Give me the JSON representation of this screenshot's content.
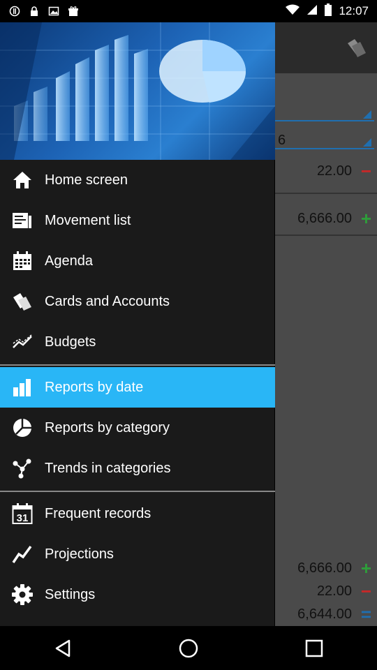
{
  "status_bar": {
    "time": "12:07"
  },
  "background": {
    "field_value": "6",
    "row_top": {
      "amount": "22.00",
      "sign": "−"
    },
    "row_second": {
      "amount": "6,666.00",
      "sign": "+"
    },
    "totals": [
      {
        "amount": "6,666.00",
        "sign": "+"
      },
      {
        "amount": "22.00",
        "sign": "−"
      },
      {
        "amount": "6,644.00",
        "sign": "="
      }
    ]
  },
  "drawer": {
    "items": [
      {
        "label": "Home screen",
        "icon": "home-icon"
      },
      {
        "label": "Movement list",
        "icon": "movement-list-icon"
      },
      {
        "label": "Agenda",
        "icon": "calendar-icon"
      },
      {
        "label": "Cards and Accounts",
        "icon": "cards-icon"
      },
      {
        "label": "Budgets",
        "icon": "budgets-icon"
      },
      {
        "label": "Reports by date",
        "icon": "bar-chart-icon",
        "active": true
      },
      {
        "label": "Reports by category",
        "icon": "pie-chart-icon"
      },
      {
        "label": "Trends in categories",
        "icon": "trends-icon"
      },
      {
        "label": "Frequent records",
        "icon": "calendar-31-icon",
        "icon_text": "31"
      },
      {
        "label": "Projections",
        "icon": "projections-icon"
      },
      {
        "label": "Settings",
        "icon": "gear-icon"
      }
    ]
  },
  "colors": {
    "accent": "#29b6f6",
    "minus": "#c62828",
    "plus": "#2e9e3a",
    "equals": "#1f6fb0"
  }
}
